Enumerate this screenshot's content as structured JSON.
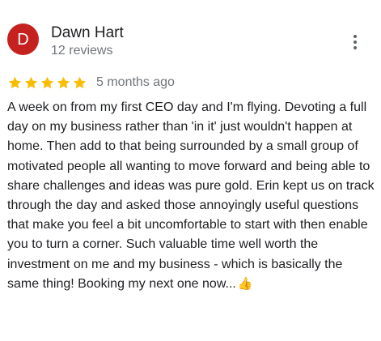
{
  "review": {
    "author": {
      "initial": "D",
      "name": "Dawn Hart",
      "reviews_count": "12 reviews",
      "avatar_color": "#c5221f"
    },
    "rating": {
      "stars": 5,
      "max": 5,
      "star_color": "#fbbc04"
    },
    "date": "5 months ago",
    "text": "A week on from my first CEO day and I'm flying. Devoting a full day on my business rather than 'in it' just wouldn't happen at home. Then add to that being surrounded by a small group of motivated people all wanting to move forward and being able to share challenges and ideas was pure gold. Erin kept us on track through the day and asked those annoyingly useful questions that make you feel a bit uncomfortable to start with then enable you to turn a corner. Such valuable time well worth the investment on me and my business - which is basically the same thing! Booking my next one now...",
    "emoji": "👍",
    "emoji_icon": "thumbs-up-icon",
    "menu_icon": "more-vert-icon"
  }
}
